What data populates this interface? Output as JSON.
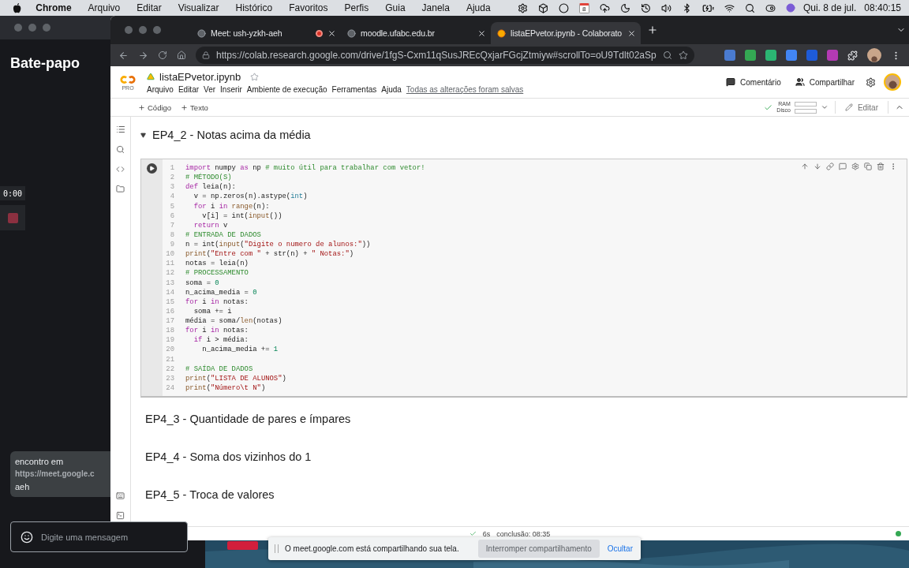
{
  "menubar": {
    "app": "Chrome",
    "menus": [
      "Arquivo",
      "Editar",
      "Visualizar",
      "Histórico",
      "Favoritos",
      "Perfis",
      "Guia",
      "Janela",
      "Ajuda"
    ],
    "calendar_day": "8",
    "date": "Qui. 8 de jul.",
    "time": "08:40:15"
  },
  "meet": {
    "title": "Bate-papo",
    "timer": "0:00",
    "message": {
      "text": "encontro em",
      "link": "https://meet.google.c",
      "tail": "aeh"
    },
    "input": {
      "placeholder": "Digite uma mensagem"
    }
  },
  "browser": {
    "tabs": [
      {
        "title": "Meet: ush-yzkh-aeh",
        "selected": false,
        "recording": true
      },
      {
        "title": "moodle.ufabc.edu.br",
        "selected": false,
        "recording": false
      },
      {
        "title": "listaEPvetor.ipynb - Colaborato",
        "selected": true,
        "recording": false
      }
    ],
    "url": "https://colab.research.google.com/drive/1fgS-Cxm11qSusJREcQxjarFGcjZtmiyw#scrollTo=oU9Tdlt02aSp"
  },
  "colab": {
    "logo_sub": "PRO",
    "notebook": "listaEPvetor.ipynb",
    "menu": [
      "Arquivo",
      "Editar",
      "Ver",
      "Inserir",
      "Ambiente de execução",
      "Ferramentas",
      "Ajuda"
    ],
    "save_status": "Todas as alterações foram salvas",
    "comment": "Comentário",
    "share": "Compartilhar",
    "add_buttons": [
      "Código",
      "Texto"
    ],
    "resources": [
      "RAM",
      "Disco"
    ],
    "edit": "Editar",
    "sections": [
      {
        "title": "EP4_2 - Notas acima da média",
        "expanded": true,
        "code": [
          {
            "n": "1",
            "s": [
              {
                "kind": "kw",
                "text": "import"
              },
              {
                "kind": "p",
                "text": " numpy "
              },
              {
                "kind": "kw",
                "text": "as"
              },
              {
                "kind": "p",
                "text": " np "
              },
              {
                "kind": "cm",
                "text": "# muito útil para trabalhar com vetor!"
              }
            ]
          },
          {
            "n": "2",
            "s": [
              {
                "kind": "cm",
                "text": "# MÉTODO(S)"
              }
            ]
          },
          {
            "n": "3",
            "s": [
              {
                "kind": "kw",
                "text": "def"
              },
              {
                "kind": "p",
                "text": " leia(n):"
              }
            ]
          },
          {
            "n": "4",
            "s": [
              {
                "kind": "p",
                "text": "  v = np.zeros(n).astype("
              },
              {
                "kind": "ty",
                "text": "int"
              },
              {
                "kind": "p",
                "text": ")"
              }
            ]
          },
          {
            "n": "5",
            "s": [
              {
                "kind": "kw",
                "text": "  for"
              },
              {
                "kind": "p",
                "text": " i "
              },
              {
                "kind": "kw",
                "text": "in"
              },
              {
                "kind": "bi",
                "text": " range"
              },
              {
                "kind": "p",
                "text": "(n):"
              }
            ]
          },
          {
            "n": "6",
            "s": [
              {
                "kind": "p",
                "text": "    v[i] = int("
              },
              {
                "kind": "bi",
                "text": "input"
              },
              {
                "kind": "p",
                "text": "())"
              }
            ]
          },
          {
            "n": "7",
            "s": [
              {
                "kind": "kw",
                "text": "  return"
              },
              {
                "kind": "p",
                "text": " v"
              }
            ]
          },
          {
            "n": "8",
            "s": [
              {
                "kind": "cm",
                "text": "# ENTRADA DE DADOS"
              }
            ]
          },
          {
            "n": "9",
            "s": [
              {
                "kind": "p",
                "text": "n = int("
              },
              {
                "kind": "bi",
                "text": "input"
              },
              {
                "kind": "p",
                "text": "("
              },
              {
                "kind": "st",
                "text": "\"Digite o numero de alunos:\""
              },
              {
                "kind": "p",
                "text": "))"
              }
            ]
          },
          {
            "n": "10",
            "s": [
              {
                "kind": "bi",
                "text": "print"
              },
              {
                "kind": "p",
                "text": "("
              },
              {
                "kind": "st",
                "text": "\"Entre com \""
              },
              {
                "kind": "p",
                "text": " + str(n) + "
              },
              {
                "kind": "st",
                "text": "\" Notas:\""
              },
              {
                "kind": "p",
                "text": ")"
              }
            ]
          },
          {
            "n": "11",
            "s": [
              {
                "kind": "p",
                "text": "notas = leia(n)"
              }
            ]
          },
          {
            "n": "12",
            "s": [
              {
                "kind": "cm",
                "text": "# PROCESSAMENTO"
              }
            ]
          },
          {
            "n": "13",
            "s": [
              {
                "kind": "p",
                "text": "soma = "
              },
              {
                "kind": "nu",
                "text": "0"
              }
            ]
          },
          {
            "n": "14",
            "s": [
              {
                "kind": "p",
                "text": "n_acima_media = "
              },
              {
                "kind": "nu",
                "text": "0"
              }
            ]
          },
          {
            "n": "15",
            "s": [
              {
                "kind": "kw",
                "text": "for"
              },
              {
                "kind": "p",
                "text": " i "
              },
              {
                "kind": "kw",
                "text": "in"
              },
              {
                "kind": "p",
                "text": " notas:"
              }
            ]
          },
          {
            "n": "16",
            "s": [
              {
                "kind": "p",
                "text": "  soma += i"
              }
            ]
          },
          {
            "n": "17",
            "s": [
              {
                "kind": "p",
                "text": "média = soma/"
              },
              {
                "kind": "bi",
                "text": "len"
              },
              {
                "kind": "p",
                "text": "(notas)"
              }
            ]
          },
          {
            "n": "18",
            "s": [
              {
                "kind": "kw",
                "text": "for"
              },
              {
                "kind": "p",
                "text": " i "
              },
              {
                "kind": "kw",
                "text": "in"
              },
              {
                "kind": "p",
                "text": " notas:"
              }
            ]
          },
          {
            "n": "19",
            "s": [
              {
                "kind": "kw",
                "text": "  if"
              },
              {
                "kind": "p",
                "text": " i > média:"
              }
            ]
          },
          {
            "n": "20",
            "s": [
              {
                "kind": "p",
                "text": "    n_acima_media += "
              },
              {
                "kind": "nu",
                "text": "1"
              }
            ]
          },
          {
            "n": "21"
          },
          {
            "n": "22",
            "s": [
              {
                "kind": "cm",
                "text": "# SAÍDA DE DADOS"
              }
            ]
          },
          {
            "n": "23",
            "s": [
              {
                "kind": "bi",
                "text": "print"
              },
              {
                "kind": "p",
                "text": "("
              },
              {
                "kind": "st",
                "text": "\"LISTA DE ALUNOS\""
              },
              {
                "kind": "p",
                "text": ")"
              }
            ]
          },
          {
            "n": "24",
            "s": [
              {
                "kind": "bi",
                "text": "print"
              },
              {
                "kind": "p",
                "text": "("
              },
              {
                "kind": "st",
                "text": "\"Número\\t N\""
              },
              {
                "kind": "p",
                "text": ")"
              }
            ]
          }
        ]
      },
      {
        "title": "EP4_3 - Quantidade de pares e ímpares",
        "expanded": false
      },
      {
        "title": "EP4_4 - Soma dos vizinhos do 1",
        "expanded": false
      },
      {
        "title": "EP4_5 - Troca de valores",
        "expanded": false
      }
    ],
    "status": {
      "duration": "6s",
      "completion": "conclusão: 08:35"
    }
  },
  "share_bar": {
    "message": "O meet.google.com está compartilhando sua tela.",
    "stop": "Interromper compartilhamento",
    "hide": "Ocultar"
  }
}
